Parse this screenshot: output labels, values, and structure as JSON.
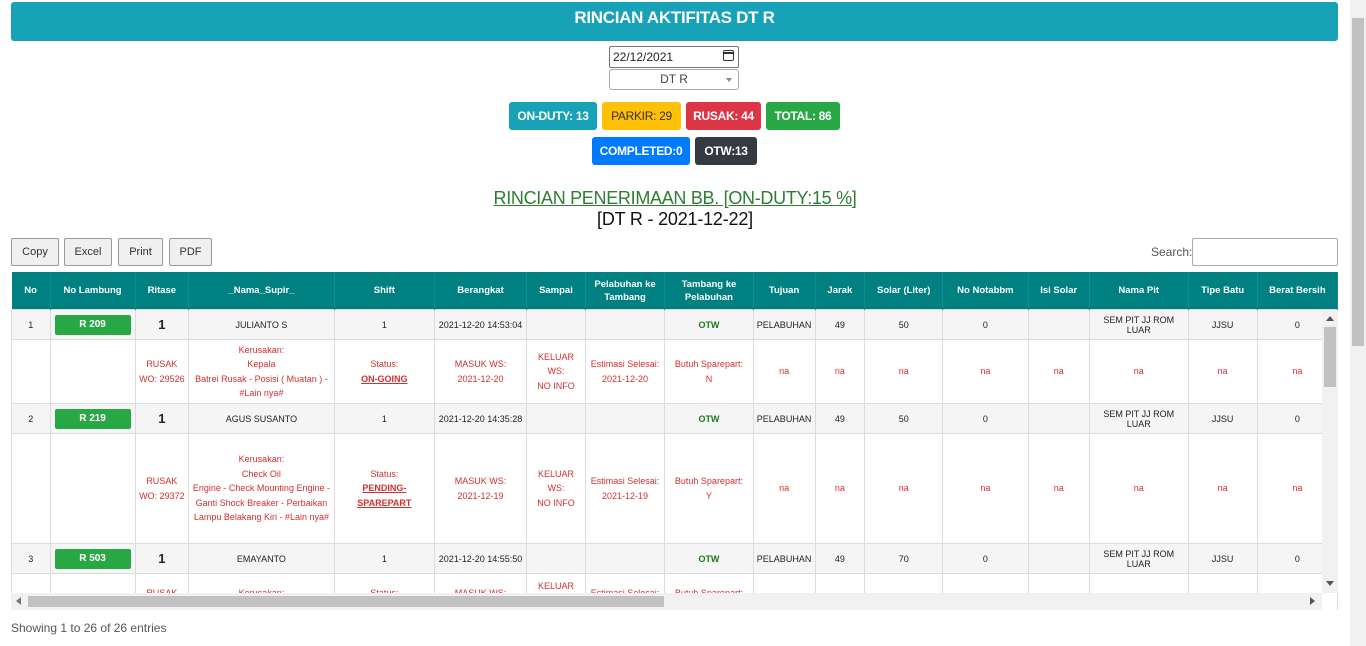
{
  "header": {
    "title": "RINCIAN AKTIFITAS DT R"
  },
  "filters": {
    "date": "22/12/2021",
    "unit": "DT R"
  },
  "badges": {
    "on_duty": "ON-DUTY: 13",
    "parkir": "PARKIR: 29",
    "rusak": "RUSAK: 44",
    "total": "TOTAL: 86",
    "completed": "COMPLETED:0",
    "otw": "OTW:13"
  },
  "colors": {
    "header": "#17a2b8",
    "on_duty": "#17a2b8",
    "parkir": "#ffc107",
    "rusak": "#dc3545",
    "total": "#28a745",
    "completed": "#007bff",
    "otw": "#343a40",
    "table_header": "#008080"
  },
  "subtitle": {
    "line1": "RINCIAN PENERIMAAN BB. [ON-DUTY:15 %]",
    "line2": "[DT R - 2021-12-22]"
  },
  "toolbar": {
    "copy": "Copy",
    "excel": "Excel",
    "print": "Print",
    "pdf": "PDF",
    "search_label": "Search:"
  },
  "table": {
    "headers": [
      "No",
      "No Lambung",
      "Ritase",
      "_Nama_Supir_",
      "Shift",
      "Berangkat",
      "Sampai",
      "Pelabuhan ke Tambang",
      "Tambang ke Pelabuhan",
      "Tujuan",
      "Jarak",
      "Solar (Liter)",
      "No Notabbm",
      "Isi Solar",
      "Nama Pit",
      "Tipe Batu",
      "Berat Bersih"
    ],
    "rows": [
      {
        "no": "1",
        "lambung": "R 209",
        "ritase": "1",
        "supir": "JULIANTO S",
        "shift": "1",
        "berangkat": "2021-12-20 14:53:04",
        "sampai": "",
        "pel_tam": "",
        "tam_pel": "OTW",
        "tujuan": "PELABUHAN",
        "jarak": "49",
        "solar": "50",
        "notabbm": "0",
        "isi_solar": "",
        "pit": "SEM PIT JJ ROM LUAR",
        "tipe": "JJSU",
        "berat": "0",
        "detail": {
          "ritase": "RUSAK\nWO: 29526",
          "supir": "Kerusakan:\nKepala\nBatrei Rusak - Posisi ( Muatan ) - #Lain nya#",
          "status_label": "Status:",
          "status": "ON-GOING",
          "berangkat": "MASUK WS:\n2021-12-20",
          "sampai": "KELUAR WS:\nNO INFO",
          "pel_tam": "Estimasi Selesai:\n2021-12-20",
          "tam_pel": "Butuh Sparepart:\nN",
          "na": "na"
        }
      },
      {
        "no": "2",
        "lambung": "R 219",
        "ritase": "1",
        "supir": "AGUS SUSANTO",
        "shift": "1",
        "berangkat": "2021-12-20 14:35:28",
        "sampai": "",
        "pel_tam": "",
        "tam_pel": "OTW",
        "tujuan": "PELABUHAN",
        "jarak": "49",
        "solar": "50",
        "notabbm": "0",
        "isi_solar": "",
        "pit": "SEM PIT JJ ROM LUAR",
        "tipe": "JJSU",
        "berat": "0",
        "detail": {
          "ritase": "RUSAK\nWO: 29372",
          "supir": "Kerusakan:\nCheck Oil\nEngine - Check Mounting Engine - Ganti Shock Breaker - Perbaikan Lampu Belakang Kiri - #Lain nya#",
          "status_label": "Status:",
          "status": "PENDING-SPAREPART",
          "berangkat": "MASUK WS:\n2021-12-19",
          "sampai": "KELUAR WS:\nNO INFO",
          "pel_tam": "Estimasi Selesai:\n2021-12-19",
          "tam_pel": "Butuh Sparepart:\nY",
          "na": "na"
        }
      },
      {
        "no": "3",
        "lambung": "R 503",
        "ritase": "1",
        "supir": "EMAYANTO",
        "shift": "1",
        "berangkat": "2021-12-20 14:55:50",
        "sampai": "",
        "pel_tam": "",
        "tam_pel": "OTW",
        "tujuan": "PELABUHAN",
        "jarak": "49",
        "solar": "70",
        "notabbm": "0",
        "isi_solar": "",
        "pit": "SEM PIT JJ ROM LUAR",
        "tipe": "JJSU",
        "berat": "0",
        "detail": {
          "ritase": "RUSAK",
          "supir": "Kerusakan:",
          "status_label": "Status:",
          "status": "",
          "berangkat": "MASUK WS:",
          "sampai": "KELUAR WS:",
          "pel_tam": "Estimasi Selesai:",
          "tam_pel": "Butuh Sparepart:",
          "na": ""
        }
      }
    ]
  },
  "footer": {
    "info": "Showing 1 to 26 of 26 entries"
  }
}
